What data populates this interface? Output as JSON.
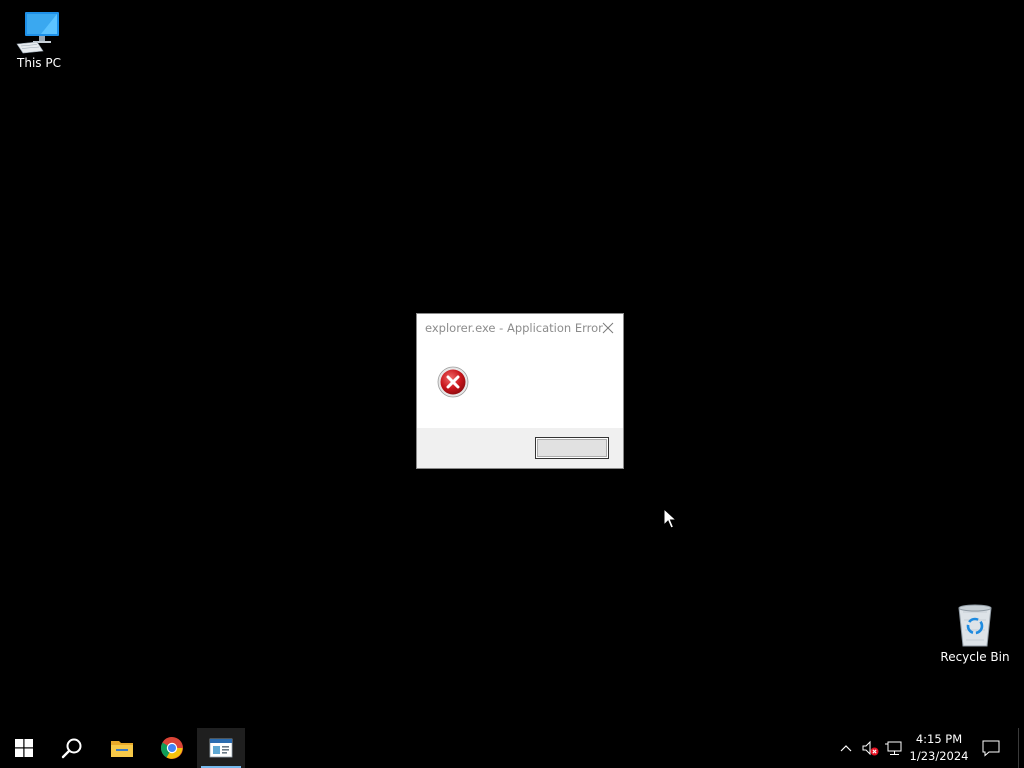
{
  "desktop": {
    "background_color": "#000000",
    "icons": [
      {
        "label": "This PC",
        "icon": "computer-icon"
      },
      {
        "label": "Recycle Bin",
        "icon": "recycle-bin-icon"
      }
    ]
  },
  "dialog": {
    "title": "explorer.exe - Application Error",
    "icon": "error-icon",
    "close_icon": "close-icon",
    "ok_label": "",
    "footer_color": "#f0f0f0"
  },
  "taskbar": {
    "items": [
      {
        "name": "start",
        "icon": "windows-logo-icon"
      },
      {
        "name": "search",
        "icon": "search-icon"
      },
      {
        "name": "file-explorer",
        "icon": "folder-icon"
      },
      {
        "name": "chrome",
        "icon": "chrome-icon"
      },
      {
        "name": "active-app",
        "icon": "application-window-icon",
        "active": true
      }
    ],
    "tray": {
      "icons": [
        "chevron-up-icon",
        "volume-muted-icon",
        "network-icon"
      ],
      "time": "4:15 PM",
      "date": "1/23/2024",
      "action_center_icon": "notification-icon"
    },
    "accent_color": "#76b9ed"
  }
}
